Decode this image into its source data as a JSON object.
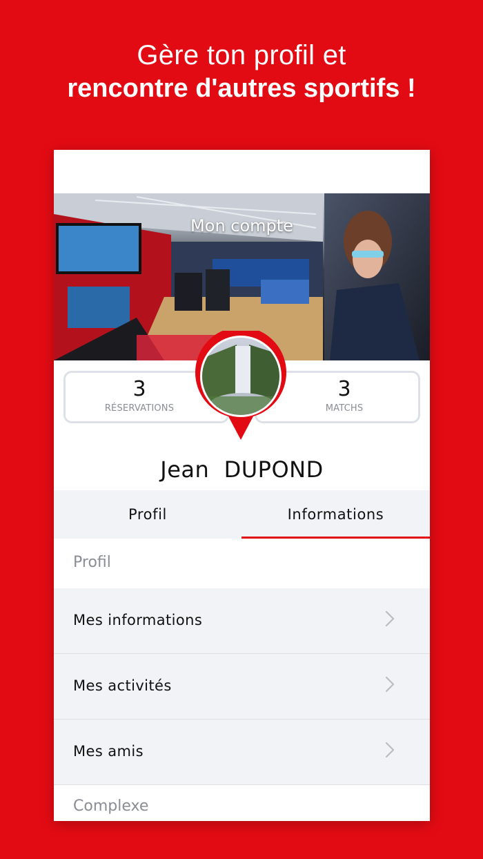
{
  "promo": {
    "line1": "Gère ton profil et",
    "line2": "rencontre d'autres sportifs !"
  },
  "header": {
    "title": "Mon compte"
  },
  "stats": {
    "reservations": {
      "value": "3",
      "label": "RÉSERVATIONS"
    },
    "matchs": {
      "value": "3",
      "label": "MATCHS"
    }
  },
  "user": {
    "name": "Jean  DUPOND"
  },
  "tabs": [
    {
      "label": "Profil",
      "active": false
    },
    {
      "label": "Informations",
      "active": true
    }
  ],
  "sections": [
    {
      "title": "Profil",
      "items": [
        {
          "label": "Mes informations",
          "icon": "chevron-right-icon"
        },
        {
          "label": "Mes activités",
          "icon": "chevron-right-icon"
        },
        {
          "label": "Mes amis",
          "icon": "chevron-right-icon"
        }
      ]
    },
    {
      "title": "Complexe",
      "items": []
    }
  ],
  "colors": {
    "brand_red": "#e30b13",
    "row_bg": "#f2f3f6",
    "muted_text": "#8a8d94"
  }
}
